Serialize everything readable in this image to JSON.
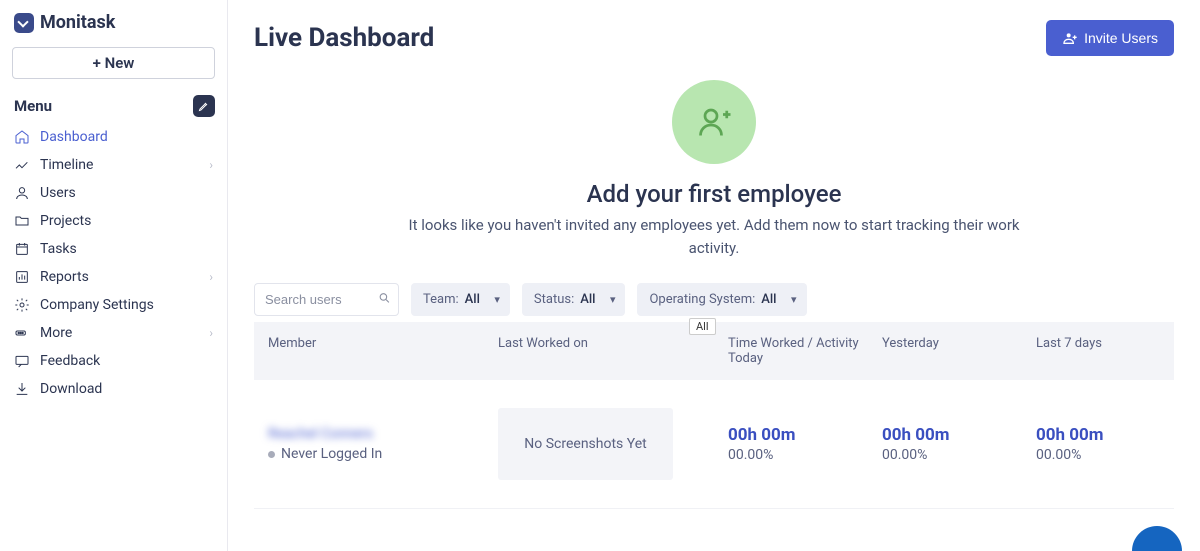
{
  "brand": "Monitask",
  "new_button": "+ New",
  "menu_label": "Menu",
  "nav": {
    "dashboard": "Dashboard",
    "timeline": "Timeline",
    "users": "Users",
    "projects": "Projects",
    "tasks": "Tasks",
    "reports": "Reports",
    "company_settings": "Company Settings",
    "more": "More",
    "feedback": "Feedback",
    "download": "Download"
  },
  "header": {
    "title": "Live Dashboard",
    "invite_button": "Invite Users"
  },
  "empty": {
    "title": "Add your first employee",
    "subtitle": "It looks like you haven't invited any employees yet. Add them now to start tracking their work activity."
  },
  "search": {
    "placeholder": "Search users"
  },
  "filters": {
    "team": {
      "label": "Team:",
      "value": "All"
    },
    "status": {
      "label": "Status:",
      "value": "All"
    },
    "os": {
      "label": "Operating System:",
      "value": "All"
    },
    "tooltip": "All"
  },
  "columns": {
    "member": "Member",
    "last_worked": "Last Worked on",
    "today": "Time Worked / Activity Today",
    "yesterday": "Yesterday",
    "last7": "Last 7 days"
  },
  "rows": [
    {
      "name": "Reachel Conners",
      "status": "Never Logged In",
      "screenshot": "No Screenshots Yet",
      "today": {
        "time": "00h 00m",
        "pct": "00.00%"
      },
      "yesterday": {
        "time": "00h 00m",
        "pct": "00.00%"
      },
      "last7": {
        "time": "00h 00m",
        "pct": "00.00%"
      }
    }
  ]
}
